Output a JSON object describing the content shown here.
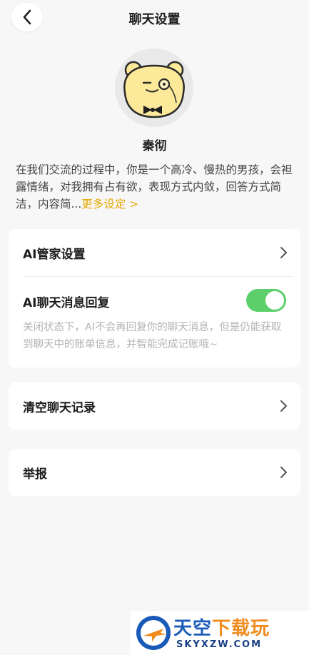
{
  "header": {
    "title": "聊天设置"
  },
  "profile": {
    "name": "秦彻",
    "description": "在我们交流的过程中，你是一个高冷、慢热的男孩，会袒露情绪，对我拥有占有欲，表现方式内敛，回答方式简洁，内容简...",
    "more_link": "更多设定 >"
  },
  "settings": {
    "ai_manager_label": "AI管家设置",
    "ai_reply_label": "AI聊天消息回复",
    "ai_reply_enabled": true,
    "ai_reply_hint": "关闭状态下，AI不会再回复你的聊天消息，但是仍能获取到聊天中的账单信息，并智能完成记账哦~",
    "clear_history_label": "清空聊天记录",
    "report_label": "举报"
  },
  "watermark": {
    "title_main": "天空",
    "title_accent": "下载玩",
    "sub": "SKYXZW.COM"
  },
  "colors": {
    "accent": "#e3a700",
    "toggle_on": "#5dcf6a"
  }
}
